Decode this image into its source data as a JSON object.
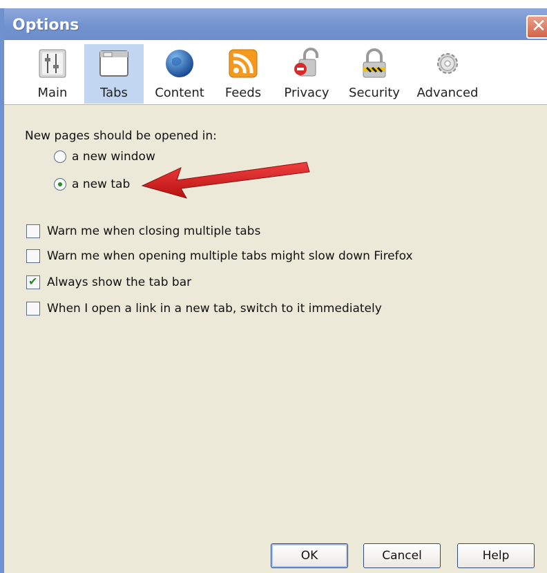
{
  "window": {
    "title": "Options",
    "close_icon": "close-icon"
  },
  "toolbar": {
    "panes": [
      {
        "label": "Main",
        "icon": "main-settings-icon",
        "selected": false
      },
      {
        "label": "Tabs",
        "icon": "tabs-window-icon",
        "selected": true
      },
      {
        "label": "Content",
        "icon": "globe-icon",
        "selected": false
      },
      {
        "label": "Feeds",
        "icon": "rss-feed-icon",
        "selected": false
      },
      {
        "label": "Privacy",
        "icon": "privacy-lock-icon",
        "selected": false
      },
      {
        "label": "Security",
        "icon": "security-padlock-icon",
        "selected": false
      },
      {
        "label": "Advanced",
        "icon": "gear-icon",
        "selected": false
      }
    ]
  },
  "tabs_pane": {
    "heading": "New pages should be opened in:",
    "radio_options": [
      {
        "label": "a new window",
        "checked": false
      },
      {
        "label": "a new tab",
        "checked": true
      }
    ],
    "checkboxes": [
      {
        "label": "Warn me when closing multiple tabs",
        "checked": false
      },
      {
        "label": "Warn me when opening multiple tabs might slow down Firefox",
        "checked": false
      },
      {
        "label": "Always show the tab bar",
        "checked": true
      },
      {
        "label": "When I open a link in a new tab, switch to it immediately",
        "checked": false
      }
    ]
  },
  "buttons": {
    "ok": "OK",
    "cancel": "Cancel",
    "help": "Help"
  },
  "colors": {
    "titlebar": "#7293cf",
    "selected_pane": "#c3d6f1",
    "dialog_bg": "#ece9d8",
    "arrow": "#d91c1c"
  }
}
